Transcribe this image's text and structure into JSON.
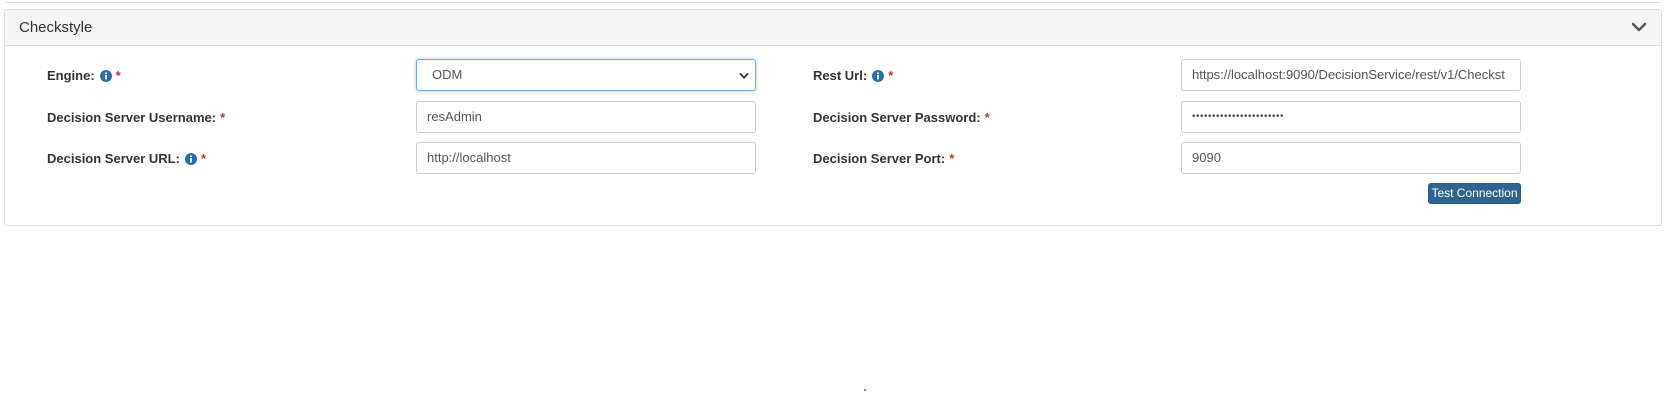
{
  "panel": {
    "title": "Checkstyle",
    "collapse_icon": "chevron-down-icon"
  },
  "form": {
    "required_marker": "*",
    "engine": {
      "label": "Engine:",
      "value": "ODM",
      "has_info": true
    },
    "rest_url": {
      "label": "Rest Url:",
      "value": "https://localhost:9090/DecisionService/rest/v1/Checkst",
      "has_info": true
    },
    "username": {
      "label": "Decision Server Username:",
      "value": "resAdmin"
    },
    "password": {
      "label": "Decision Server Password:",
      "value": "•••••••••••••••••••••••"
    },
    "server_url": {
      "label": "Decision Server URL:",
      "value": "http://localhost",
      "has_info": true
    },
    "port": {
      "label": "Decision Server Port:",
      "value": "9090"
    }
  },
  "actions": {
    "test_connection_label": "Test Connection"
  },
  "colors": {
    "required": "#c9302c",
    "info_icon": "#2e6da4",
    "button": "#2e6491",
    "focus_border": "#66afe9"
  }
}
